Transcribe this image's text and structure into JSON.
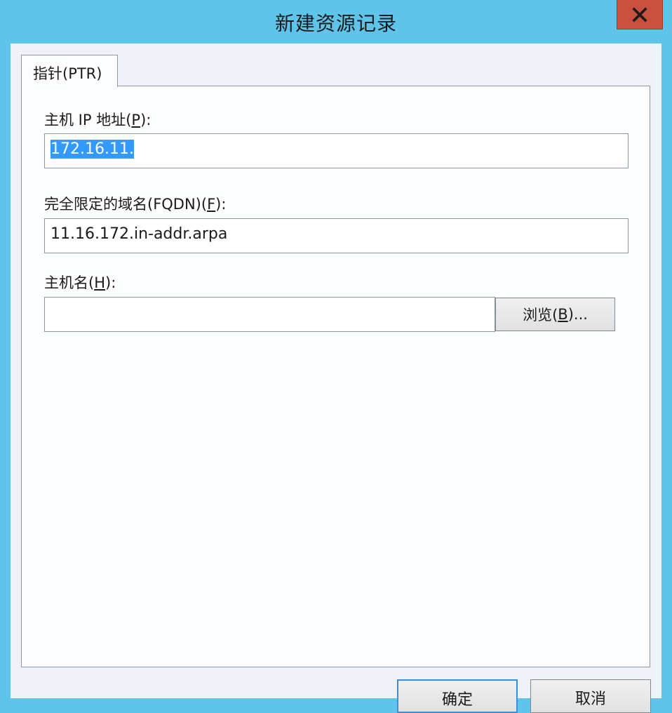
{
  "window": {
    "title": "新建资源记录",
    "close_symbol": "✕"
  },
  "tab": {
    "label": "指针(PTR)"
  },
  "form": {
    "ip_label_pre": "主机 IP 地址(",
    "ip_label_key": "P",
    "ip_label_post": "):",
    "ip_value": "172.16.11.",
    "fqdn_label_pre": "完全限定的域名(FQDN)(",
    "fqdn_label_key": "F",
    "fqdn_label_post": "):",
    "fqdn_value": "11.16.172.in-addr.arpa",
    "host_label_pre": "主机名(",
    "host_label_key": "H",
    "host_label_post": "):",
    "host_value": "",
    "browse_pre": "浏览(",
    "browse_key": "B",
    "browse_post": ")..."
  },
  "footer": {
    "ok_label": "确定",
    "cancel_label": "取消"
  },
  "icons": {
    "close": "close-icon"
  },
  "colors": {
    "title_bar": "#5ec4ea",
    "close_button": "#c9503f",
    "selection": "#3399ff"
  }
}
